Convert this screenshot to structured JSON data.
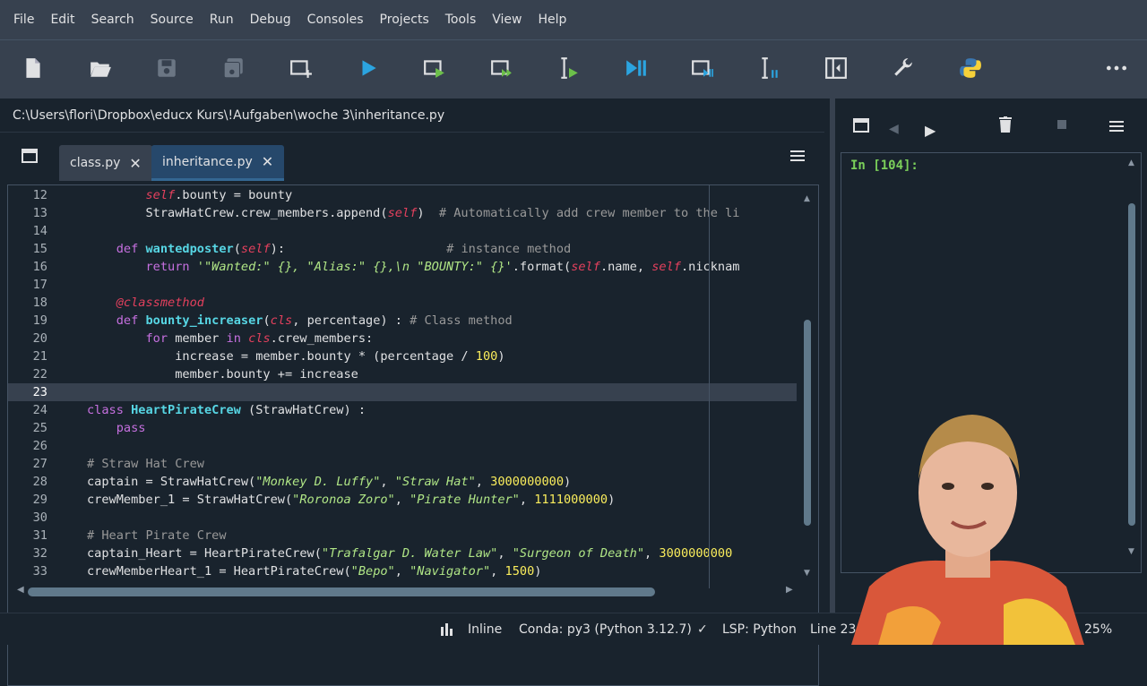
{
  "menu": [
    "File",
    "Edit",
    "Search",
    "Source",
    "Run",
    "Debug",
    "Consoles",
    "Projects",
    "Tools",
    "View",
    "Help"
  ],
  "toolbar_icons": [
    "new-file-icon",
    "open-folder-icon",
    "save-icon",
    "save-all-icon",
    "new-cell-icon",
    "run-icon",
    "run-cell-icon",
    "run-cell-advance-icon",
    "run-selection-icon",
    "debug-icon",
    "debug-cell-icon",
    "debug-selection-icon",
    "maximize-pane-icon",
    "preferences-icon",
    "python-path-icon",
    "more-icon"
  ],
  "editor": {
    "path": "C:\\Users\\flori\\Dropbox\\educx Kurs\\!Aufgaben\\woche 3\\inheritance.py",
    "tabs": [
      {
        "label": "class.py",
        "active": false
      },
      {
        "label": "inheritance.py",
        "active": true
      }
    ],
    "line_numbers": [
      "12",
      "13",
      "14",
      "15",
      "16",
      "17",
      "18",
      "19",
      "20",
      "21",
      "22",
      "23",
      "24",
      "25",
      "26",
      "27",
      "28",
      "29",
      "30",
      "31",
      "32",
      "33"
    ],
    "current_line": "23"
  },
  "console": {
    "prompt": "In [104]:"
  },
  "status": {
    "inline": "Inline",
    "conda": "Conda: py3 (Python 3.12.7)",
    "lsp": "LSP: Python",
    "line": "Line 23",
    "zoom": "25%"
  },
  "colors": {
    "background": "#19232d",
    "bar": "#37414f",
    "active_tab": "#26486b",
    "keyword": "#c670e0",
    "string": "#b0e686",
    "number": "#faed5c",
    "self": "#e3405d"
  }
}
